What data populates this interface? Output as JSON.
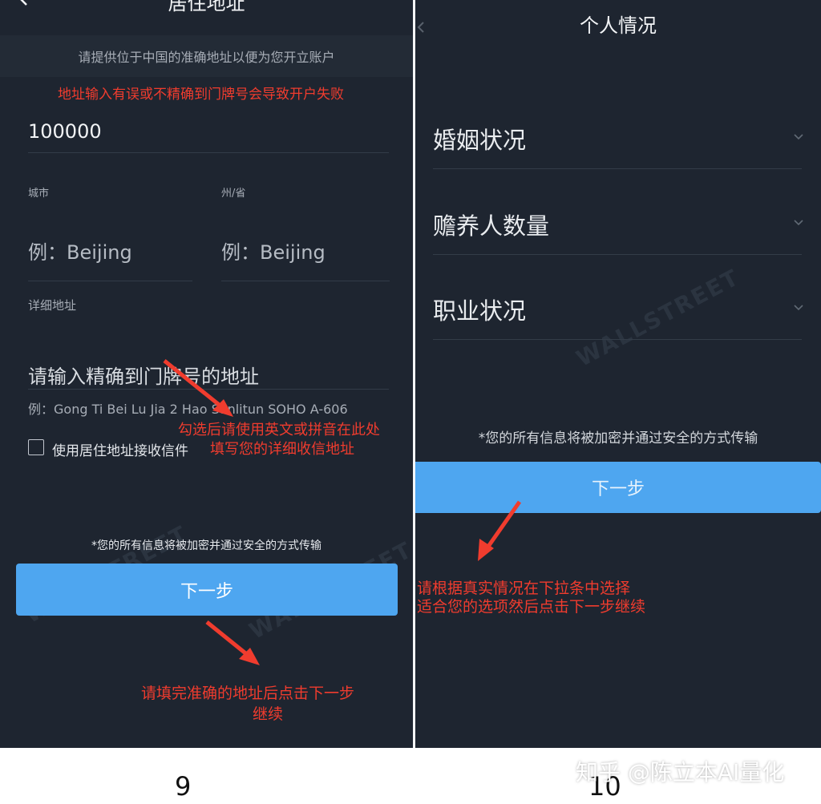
{
  "left": {
    "title": "居住地址",
    "banner": "请提供位于中国的准确地址以便为您开立账户",
    "warning": "地址输入有误或不精确到门牌号会导致开户失败",
    "postal_code_value": "100000",
    "city_label": "城市",
    "province_label": "州/省",
    "city_placeholder": "例：Beijing",
    "province_placeholder": "例：Beijing",
    "detail_label": "详细地址",
    "detail_placeholder": "请输入精确到门牌号的地址",
    "detail_example": "例：Gong Ti Bei Lu Jia 2 Hao Sanlitun SOHO A-606",
    "mailing_checkbox_label": "使用居住地址接收信件",
    "annotation_detail_line1": "勾选后请使用英文或拼音在此处",
    "annotation_detail_line2": "填写您的详细收信地址",
    "security_note": "*您的所有信息将被加密并通过安全的方式传输",
    "next_button": "下一步",
    "annotation_next_line1": "请填完准确的地址后点击下一步",
    "annotation_next_line2": "继续"
  },
  "right": {
    "title": "个人情况",
    "marital_status": "婚姻状况",
    "dependents": "赡养人数量",
    "employment_status": "职业状况",
    "security_note": "*您的所有信息将被加密并通过安全的方式传输",
    "next_button": "下一步",
    "annotation_line1": "请根据真实情况在下拉条中选择",
    "annotation_line2": "适合您的选项然后点击下一步继续"
  },
  "captions": {
    "left_step": "9",
    "right_step": "10",
    "watermark": "知乎 @陈立本AI量化"
  },
  "colors": {
    "panel_bg": "#1e2530",
    "button_blue": "#4ea6f0",
    "annotation_red": "#f03c2e"
  }
}
